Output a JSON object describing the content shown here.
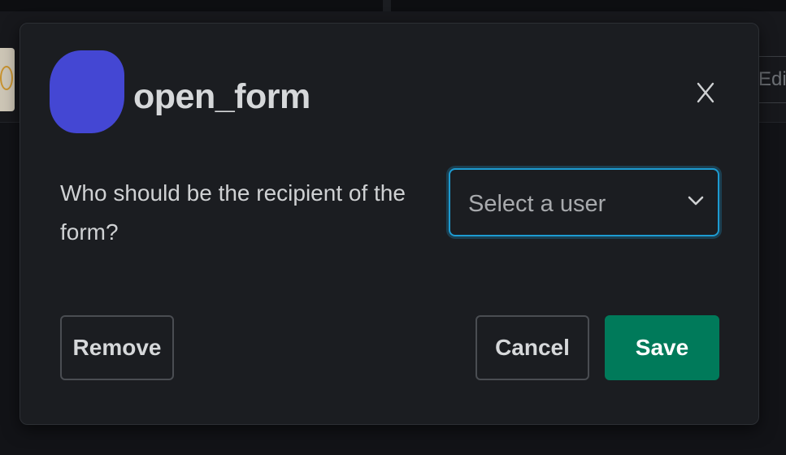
{
  "background": {
    "edit_button_label": "Edit"
  },
  "modal": {
    "title": "open_form",
    "close_icon": "close-icon",
    "question": "Who should be the recipient of the form?",
    "user_select": {
      "placeholder": "Select a user",
      "chevron_icon": "chevron-down-icon"
    },
    "buttons": {
      "remove": "Remove",
      "cancel": "Cancel",
      "save": "Save"
    }
  },
  "colors": {
    "accent": "#1d9bd1",
    "save_button": "#007a5a",
    "avatar": "#4447d3",
    "modal_background": "#1b1d21"
  }
}
